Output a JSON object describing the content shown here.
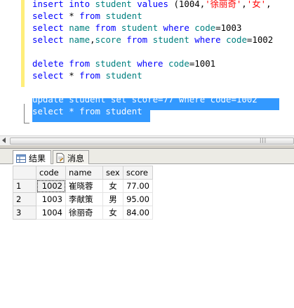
{
  "editor": {
    "lines": [
      {
        "tokens": [
          {
            "t": "insert into ",
            "c": "kw"
          },
          {
            "t": "student ",
            "c": "id"
          },
          {
            "t": "values ",
            "c": "kw"
          },
          {
            "t": "(1004,",
            "c": "num"
          },
          {
            "t": "'徐丽奇'",
            "c": "str"
          },
          {
            "t": ",",
            "c": "num"
          },
          {
            "t": "'女'",
            "c": "str"
          },
          {
            "t": ",",
            "c": "num"
          }
        ]
      },
      {
        "tokens": [
          {
            "t": "select ",
            "c": "kw"
          },
          {
            "t": "* ",
            "c": "num"
          },
          {
            "t": "from ",
            "c": "kw"
          },
          {
            "t": "student",
            "c": "id"
          }
        ]
      },
      {
        "tokens": [
          {
            "t": "select ",
            "c": "kw"
          },
          {
            "t": "name ",
            "c": "id"
          },
          {
            "t": "from ",
            "c": "kw"
          },
          {
            "t": "student ",
            "c": "id"
          },
          {
            "t": "where ",
            "c": "kw"
          },
          {
            "t": "code",
            "c": "id"
          },
          {
            "t": "=1003",
            "c": "num"
          }
        ]
      },
      {
        "tokens": [
          {
            "t": "select ",
            "c": "kw"
          },
          {
            "t": "name",
            "c": "id"
          },
          {
            "t": ",",
            "c": "num"
          },
          {
            "t": "score ",
            "c": "id"
          },
          {
            "t": "from ",
            "c": "kw"
          },
          {
            "t": "student ",
            "c": "id"
          },
          {
            "t": "where ",
            "c": "kw"
          },
          {
            "t": "code",
            "c": "id"
          },
          {
            "t": "=1002",
            "c": "num"
          }
        ]
      },
      {
        "tokens": []
      },
      {
        "tokens": [
          {
            "t": "delete ",
            "c": "kw"
          },
          {
            "t": "from ",
            "c": "kw"
          },
          {
            "t": "student ",
            "c": "id"
          },
          {
            "t": "where ",
            "c": "kw"
          },
          {
            "t": "code",
            "c": "id"
          },
          {
            "t": "=1001",
            "c": "num"
          }
        ]
      },
      {
        "tokens": [
          {
            "t": "select ",
            "c": "kw"
          },
          {
            "t": "* ",
            "c": "num"
          },
          {
            "t": "from ",
            "c": "kw"
          },
          {
            "t": "student",
            "c": "id"
          }
        ]
      },
      {
        "tokens": []
      },
      {
        "tokens": [
          {
            "t": "update student set score=77 where code=1002",
            "c": "num"
          }
        ],
        "selected": true
      },
      {
        "tokens": [
          {
            "t": "select * from student",
            "c": "num"
          }
        ],
        "selected": true
      }
    ]
  },
  "tabs": {
    "results_label": "结果",
    "messages_label": "消息"
  },
  "results": {
    "columns": [
      "code",
      "name",
      "sex",
      "score"
    ],
    "rows": [
      {
        "rownum": "1",
        "code": "1002",
        "name": "崔晓蓉",
        "sex": "女",
        "score": "77.00"
      },
      {
        "rownum": "2",
        "code": "1003",
        "name": "李献策",
        "sex": "男",
        "score": "95.00"
      },
      {
        "rownum": "3",
        "code": "1004",
        "name": "徐丽奇",
        "sex": "女",
        "score": "84.00"
      }
    ]
  },
  "colors": {
    "keyword": "#0000ff",
    "identifier": "#008080",
    "string": "#ff0000",
    "selection": "#3399ff"
  }
}
